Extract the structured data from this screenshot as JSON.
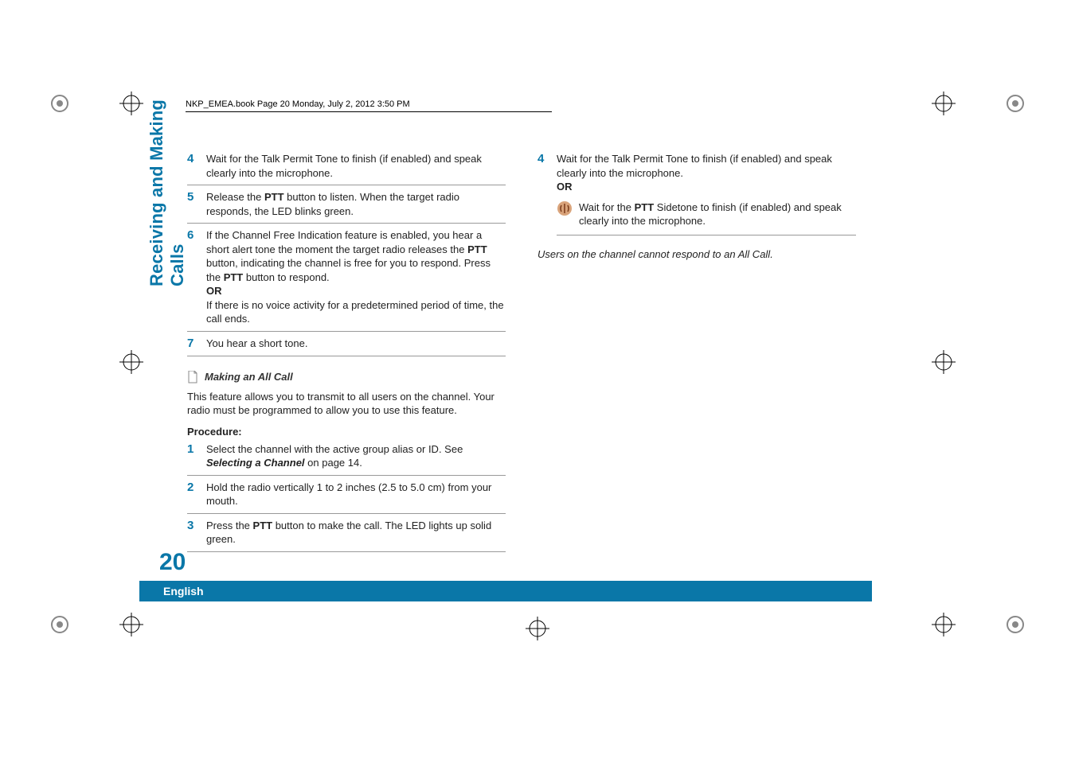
{
  "header": {
    "running_head": "NKP_EMEA.book  Page 20  Monday, July 2, 2012  3:50 PM"
  },
  "side_tab": "Receiving and Making Calls",
  "page_number": "20",
  "language": "English",
  "left_column": {
    "steps_a": [
      {
        "num": "4",
        "text_pre": "Wait for the Talk Permit Tone to finish (if enabled) and speak clearly into the microphone."
      },
      {
        "num": "5",
        "text_pre": "Release the ",
        "bold1": "PTT",
        "text_mid": " button to listen. When the target radio responds, the LED blinks green."
      },
      {
        "num": "6",
        "text_pre": "If the Channel Free Indication feature is enabled, you hear a short alert tone the moment the target radio releases the ",
        "bold1": "PTT",
        "text_mid": " button, indicating the channel is free for you to respond. Press the ",
        "bold2": "PTT",
        "text_post": " button to respond.",
        "or": "OR",
        "after_or": "If there is no voice activity for a predetermined period of time, the call ends."
      },
      {
        "num": "7",
        "text_pre": "You hear a short tone."
      }
    ],
    "section_title": "Making an All Call",
    "section_desc": "This feature allows you to transmit to all users on the channel. Your radio must be programmed to allow you to use this feature.",
    "procedure_label": "Procedure:",
    "steps_b": [
      {
        "num": "1",
        "text_pre": "Select the channel with the active group alias or ID. See ",
        "bolditalic": "Selecting a Channel",
        "text_post": " on page 14."
      },
      {
        "num": "2",
        "text_pre": "Hold the radio vertically 1 to 2 inches (2.5 to 5.0 cm) from your mouth."
      },
      {
        "num": "3",
        "text_pre": "Press the ",
        "bold1": "PTT",
        "text_post": " button to make the call. The LED lights up solid green."
      }
    ]
  },
  "right_column": {
    "step4": {
      "num": "4",
      "text": "Wait for the Talk Permit Tone to finish (if enabled) and speak clearly into the microphone.",
      "or": "OR",
      "note_pre": " Wait for the ",
      "note_bold": "PTT",
      "note_post": " Sidetone to finish (if enabled) and speak clearly into the microphone."
    },
    "italic_note": "Users on the channel cannot respond to an All Call."
  }
}
